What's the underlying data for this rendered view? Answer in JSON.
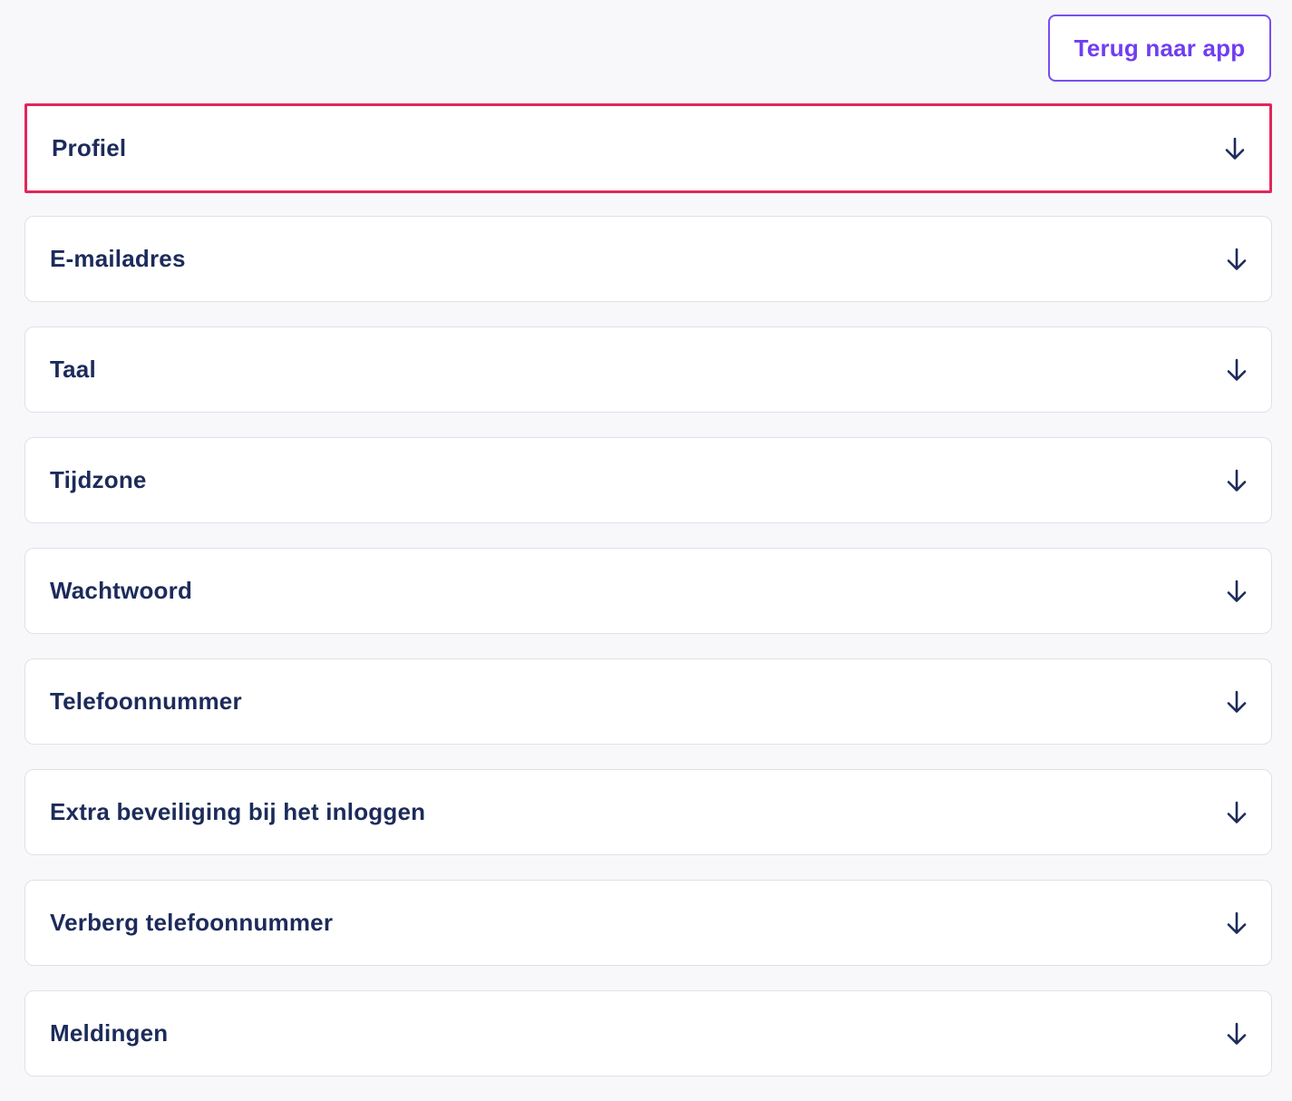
{
  "header": {
    "back_button_label": "Terug naar app"
  },
  "colors": {
    "accent": "#6f3ef0",
    "highlight_border": "#e0275a",
    "label_text": "#1c2b5a",
    "page_background": "#f8f8fb"
  },
  "sections": [
    {
      "label": "Profiel",
      "icon": "arrow-down-icon"
    },
    {
      "label": "E-mailadres",
      "icon": "arrow-down-icon"
    },
    {
      "label": "Taal",
      "icon": "arrow-down-icon"
    },
    {
      "label": "Tijdzone",
      "icon": "arrow-down-icon"
    },
    {
      "label": "Wachtwoord",
      "icon": "arrow-down-icon"
    },
    {
      "label": "Telefoonnummer",
      "icon": "arrow-down-icon"
    },
    {
      "label": "Extra beveiliging bij het inloggen",
      "icon": "arrow-down-icon"
    },
    {
      "label": "Verberg telefoonnummer",
      "icon": "arrow-down-icon"
    },
    {
      "label": "Meldingen",
      "icon": "arrow-down-icon"
    }
  ]
}
